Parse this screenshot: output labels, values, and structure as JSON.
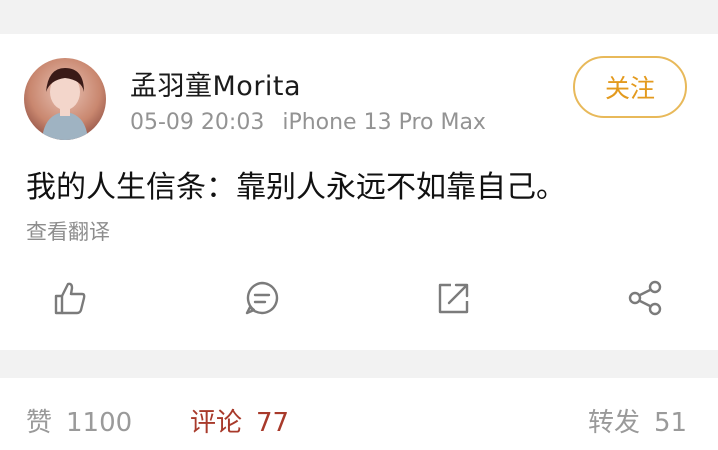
{
  "post": {
    "username": "孟羽童Morita",
    "date": "05-09 20:03",
    "device": "iPhone 13 Pro Max",
    "follow_label": "关注",
    "text": "我的人生信条：靠别人永远不如靠自己。",
    "translate_label": "查看翻译"
  },
  "actions": {
    "like_icon": "thumbs-up-icon",
    "comment_icon": "comment-icon",
    "repost_icon": "share-external-icon",
    "share_icon": "share-network-icon"
  },
  "stats": {
    "likes_label": "赞",
    "likes_count": "1100",
    "comments_label": "评论",
    "comments_count": "77",
    "reposts_label": "转发",
    "reposts_count": "51"
  },
  "colors": {
    "accent": "#e39a1e",
    "active_tab": "#a83a2b",
    "muted": "#939393",
    "divider_bg": "#f2f2f2"
  }
}
